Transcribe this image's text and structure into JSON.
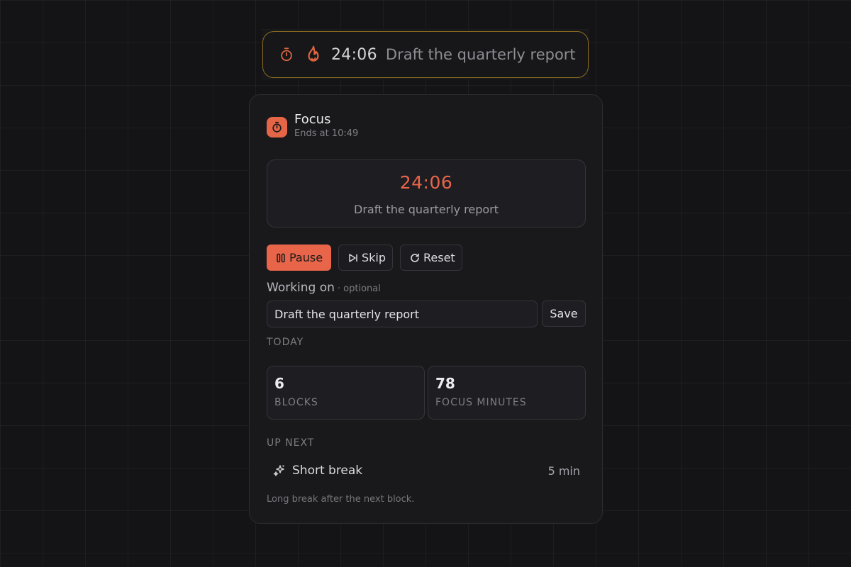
{
  "pill": {
    "time": "24:06",
    "task": "Draft the quarterly report",
    "timer_icon": "stopwatch-icon",
    "flame_icon": "flame-icon"
  },
  "header": {
    "title": "Focus",
    "subtitle": "Ends at 10:49",
    "icon": "stopwatch-icon"
  },
  "timer": {
    "time": "24:06",
    "task": "Draft the quarterly report"
  },
  "controls": {
    "pause_label": "Pause",
    "skip_label": "Skip",
    "reset_label": "Reset"
  },
  "working_on": {
    "label": "Working on",
    "optional": "· optional",
    "value": "Draft the quarterly report",
    "save_label": "Save"
  },
  "today": {
    "label": "TODAY",
    "stats": [
      {
        "value": "6",
        "label": "BLOCKS"
      },
      {
        "value": "78",
        "label": "FOCUS MINUTES"
      }
    ]
  },
  "up_next": {
    "label": "UP NEXT",
    "name": "Short break",
    "duration": "5 min",
    "icon": "sparkle-icon"
  },
  "footnote": "Long break after the next block.",
  "colors": {
    "accent": "#e8654a",
    "pill_border": "#8a6d1f",
    "background": "#141417",
    "card": "#19191c"
  }
}
